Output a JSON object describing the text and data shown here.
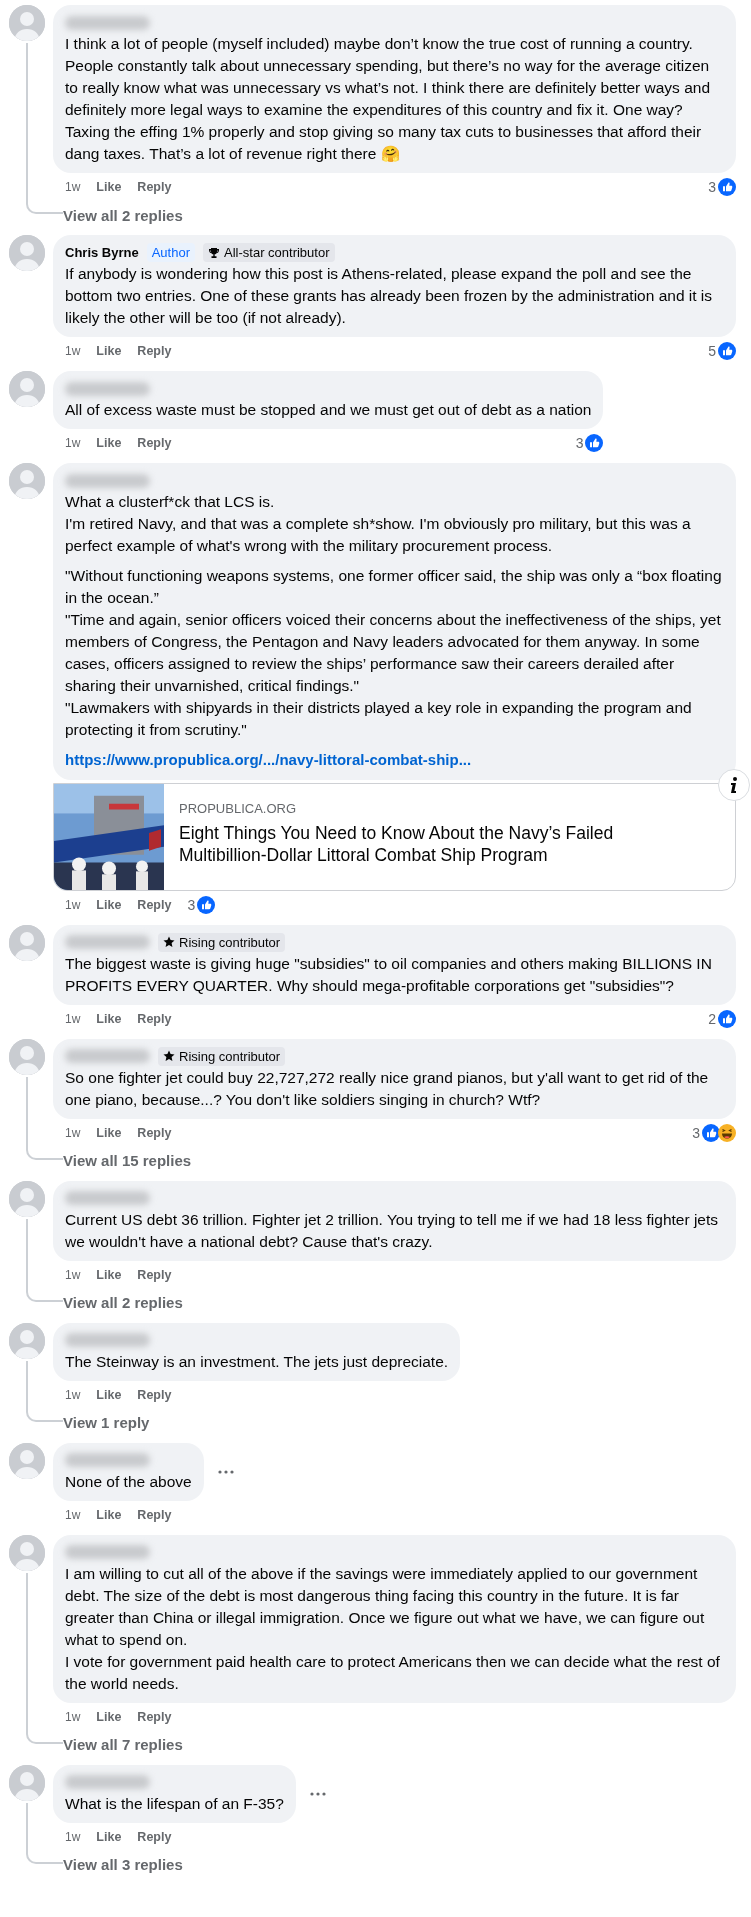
{
  "comments": [
    {
      "paragraphs": [
        "I think a lot of people (myself included) maybe don’t know the true cost of running a country. People constantly talk about unnecessary spending, but there’s no way for the average citizen to really know what was unnecessary vs what’s not. I think there are definitely better ways and definitely more legal ways to examine the expenditures of this country and fix it. One way? Taxing the effing 1% properly and stop giving so many tax cuts to businesses that afford their dang taxes. That’s a lot of revenue right there 🤗"
      ],
      "time": "1w",
      "like": "Like",
      "reply": "Reply",
      "reactions": {
        "count": "3",
        "like": true,
        "inline": false
      },
      "view_replies": "View all 2 replies"
    },
    {
      "author": "Chris Byrne",
      "badges": [
        {
          "kind": "author",
          "label": "Author"
        },
        {
          "kind": "allstar",
          "label": "All-star contributor"
        }
      ],
      "paragraphs": [
        "If anybody is wondering how this post is Athens-related, please expand the poll and see the bottom two entries. One of these grants has already been frozen by the administration and it is likely the other will be too (if not already)."
      ],
      "time": "1w",
      "like": "Like",
      "reply": "Reply",
      "reactions": {
        "count": "5",
        "like": true,
        "inline": false
      }
    },
    {
      "paragraphs": [
        "All of excess waste must be stopped and we must get out of debt as a nation"
      ],
      "time": "1w",
      "like": "Like",
      "reply": "Reply",
      "reactions": {
        "count": "3",
        "like": true,
        "inline": false
      }
    },
    {
      "paragraphs": [
        "What a clusterf*ck that LCS is.\nI'm retired Navy, and that was a complete sh*show. I'm obviously pro military, but this was a perfect example of what's wrong with the military procurement process.",
        "\"Without functioning weapons systems, one former officer said, the ship was only a “box floating in the ocean.”\n\"Time and again, senior officers voiced their concerns about the ineffectiveness of the ships, yet members of Congress, the Pentagon and Navy leaders advocated for them anyway. In some cases, officers assigned to review the ships’ performance saw their careers derailed after sharing their unvarnished, critical findings.\"\n\"Lawmakers with shipyards in their districts played a key role in expanding the program and protecting it from scrutiny.\""
      ],
      "link": "https://www.propublica.org/.../navy-littoral-combat-ship...",
      "link_preview": {
        "source": "PROPUBLICA.ORG",
        "title": "Eight Things You Need to Know About the Navy’s Failed Multibillion-Dollar Littoral Combat Ship Program"
      },
      "time": "1w",
      "like": "Like",
      "reply": "Reply",
      "reactions": {
        "count": "3",
        "like": true,
        "inline": true
      }
    },
    {
      "badges": [
        {
          "kind": "rising",
          "label": "Rising contributor"
        }
      ],
      "paragraphs": [
        "The biggest waste is giving huge \"subsidies\" to oil companies and others making BILLIONS IN PROFITS EVERY QUARTER. Why should mega-profitable corporations get \"subsidies\"?"
      ],
      "time": "1w",
      "like": "Like",
      "reply": "Reply",
      "reactions": {
        "count": "2",
        "like": true,
        "inline": false
      }
    },
    {
      "badges": [
        {
          "kind": "rising",
          "label": "Rising contributor"
        }
      ],
      "paragraphs": [
        "So one fighter jet could buy 22,727,272 really nice grand pianos, but y'all want to get rid of the one piano, because...? You don't like soldiers singing in church? Wtf?"
      ],
      "time": "1w",
      "like": "Like",
      "reply": "Reply",
      "reactions": {
        "count": "3",
        "like": true,
        "haha": true,
        "inline": false
      },
      "view_replies": "View all 15 replies"
    },
    {
      "paragraphs": [
        "Current US debt 36 trillion. Fighter jet 2 trillion. You trying to tell me if we had 18 less fighter jets we wouldn't have a national debt? Cause that's crazy."
      ],
      "time": "1w",
      "like": "Like",
      "reply": "Reply",
      "view_replies": "View all 2 replies"
    },
    {
      "paragraphs": [
        "The Steinway is an investment. The jets just depreciate."
      ],
      "time": "1w",
      "like": "Like",
      "reply": "Reply",
      "view_replies": "View 1 reply"
    },
    {
      "paragraphs": [
        "None of the above"
      ],
      "more_menu": true,
      "time": "1w",
      "like": "Like",
      "reply": "Reply"
    },
    {
      "paragraphs": [
        "I am willing to cut all of the above if the savings were immediately applied to our government debt. The size of the debt is most dangerous thing facing this country in the future. It is far greater than China or illegal immigration. Once we figure out what we have, we can figure out what to spend on.\nI vote for government paid health care to protect Americans then we can decide what the rest of the world needs."
      ],
      "time": "1w",
      "like": "Like",
      "reply": "Reply",
      "view_replies": "View all 7 replies"
    },
    {
      "paragraphs": [
        "What is the lifespan of an F-35?"
      ],
      "more_menu": true,
      "time": "1w",
      "like": "Like",
      "reply": "Reply",
      "view_replies": "View all 3 replies"
    }
  ]
}
